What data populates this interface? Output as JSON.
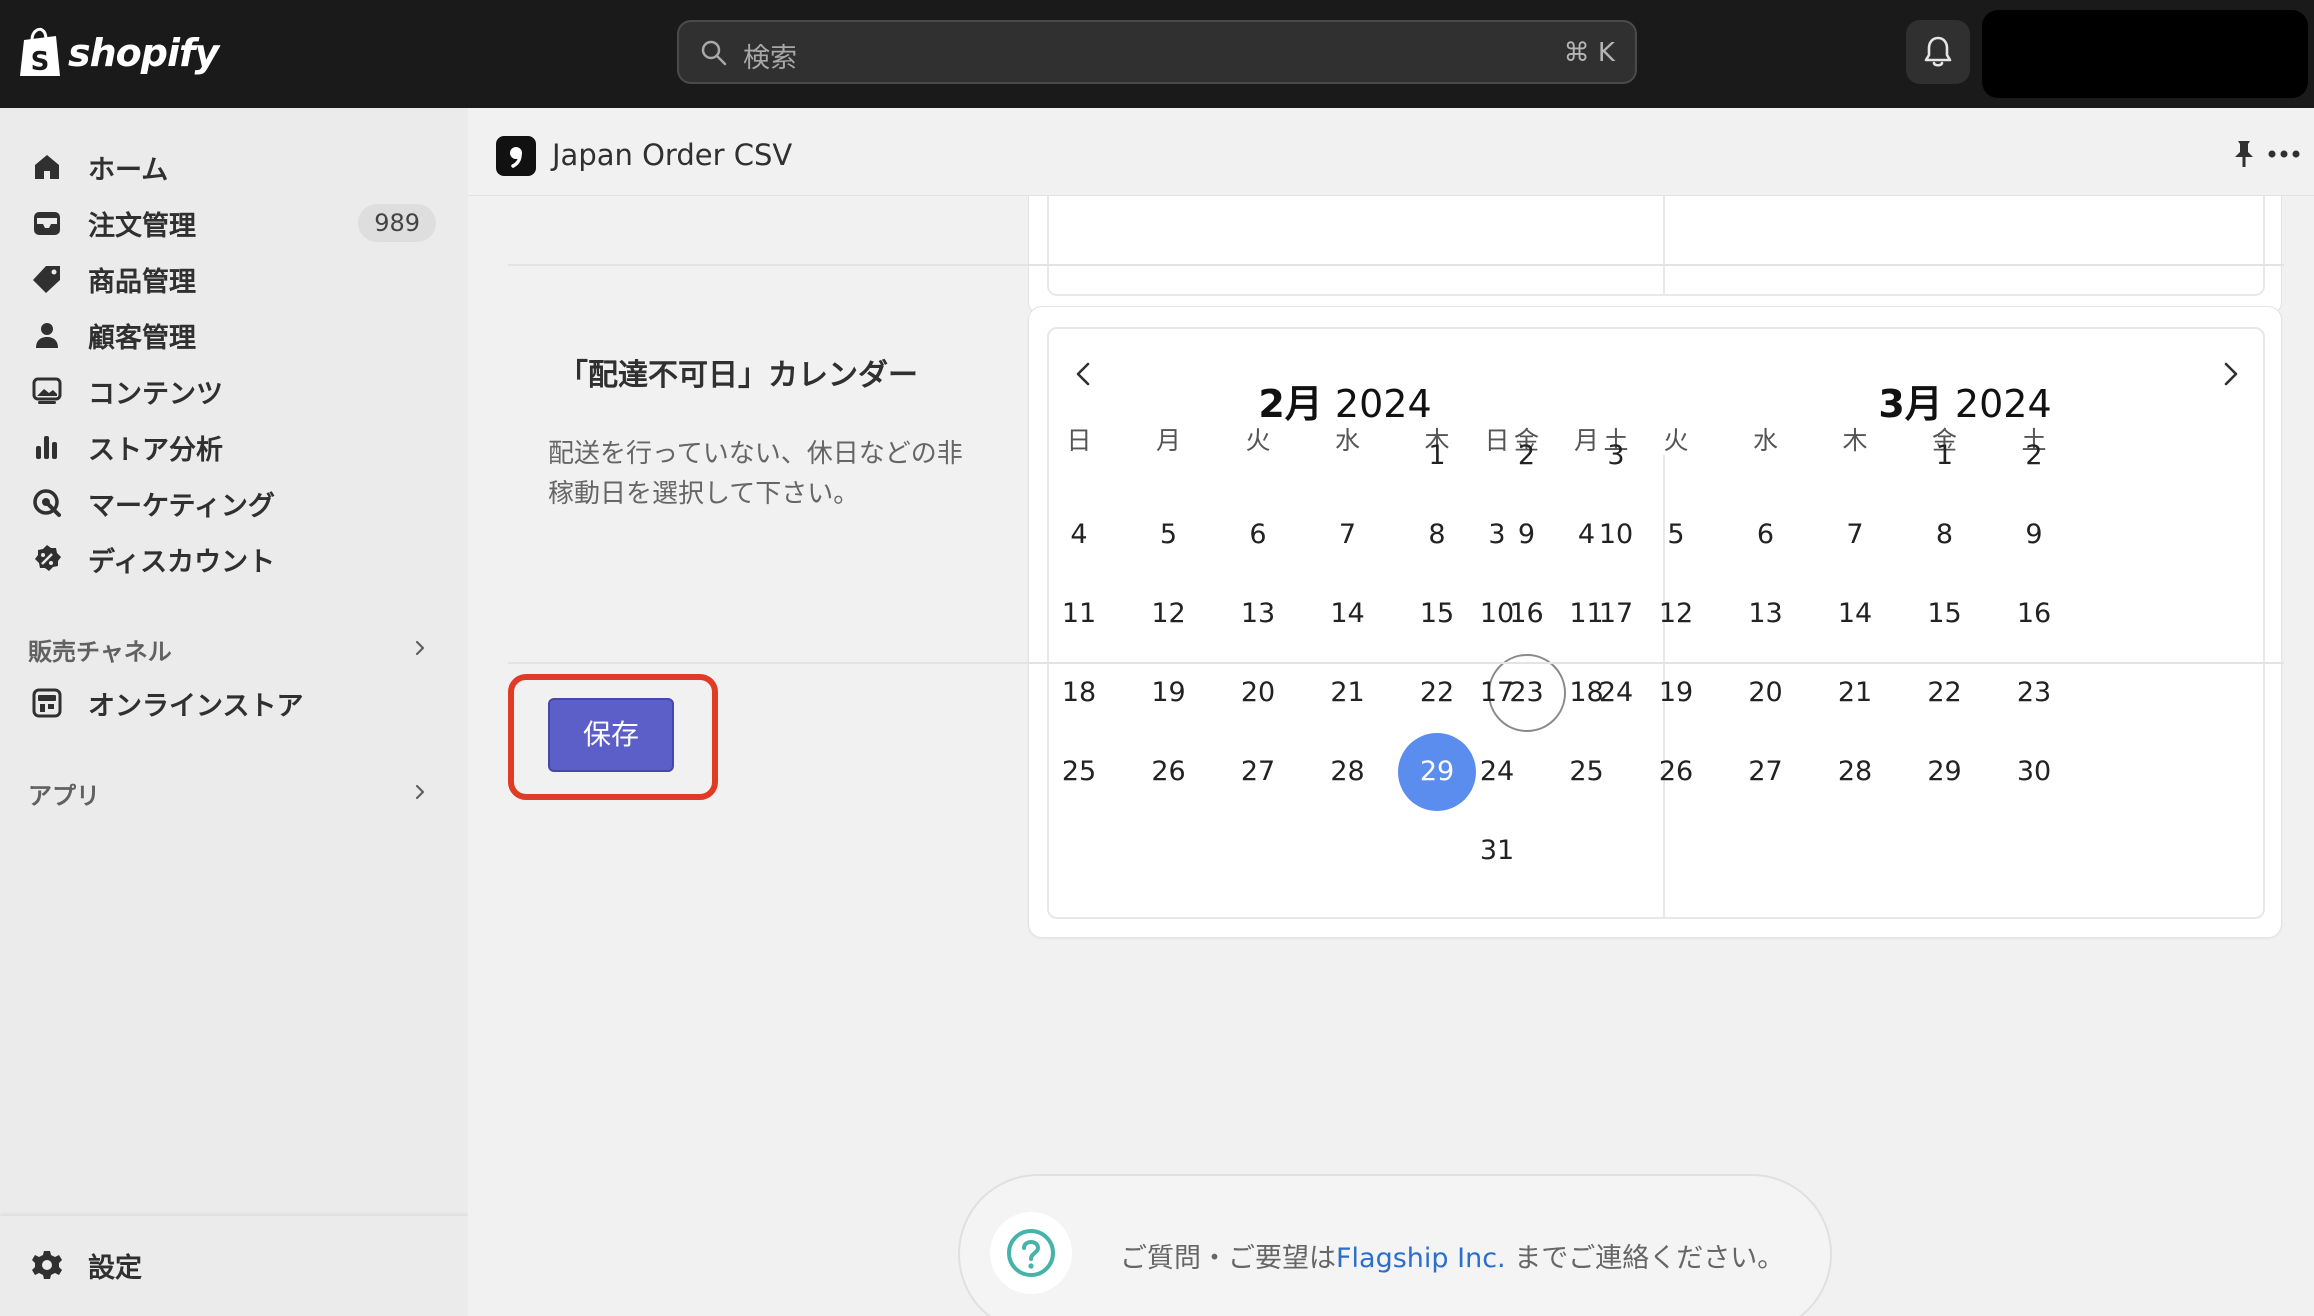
{
  "topbar": {
    "logo_text": "shopify",
    "search_placeholder": "検索",
    "search_shortcut": "⌘ K",
    "bell_icon": "bell-icon"
  },
  "sidebar": {
    "items": [
      {
        "label": "ホーム",
        "icon": "home-icon"
      },
      {
        "label": "注文管理",
        "icon": "inbox-icon",
        "badge": "989"
      },
      {
        "label": "商品管理",
        "icon": "tag-icon"
      },
      {
        "label": "顧客管理",
        "icon": "person-icon"
      },
      {
        "label": "コンテンツ",
        "icon": "image-icon"
      },
      {
        "label": "ストア分析",
        "icon": "bar-chart-icon"
      },
      {
        "label": "マーケティング",
        "icon": "target-icon"
      },
      {
        "label": "ディスカウント",
        "icon": "discount-icon"
      }
    ],
    "sales_channel_label": "販売チャネル",
    "online_store_label": "オンラインストア",
    "apps_label": "アプリ",
    "settings_label": "設定"
  },
  "app": {
    "title": "Japan Order CSV"
  },
  "section": {
    "title": "「配達不可日」カレンダー",
    "description": "配送を行っていない、休日などの非稼動日を選択して下さい。"
  },
  "calendar": {
    "weekdays": [
      "日",
      "月",
      "火",
      "水",
      "木",
      "金",
      "土"
    ],
    "months": [
      {
        "month_label": "2月",
        "year_label": "2024",
        "first_weekday": 4,
        "days": 29,
        "today": 23,
        "selected": [
          29
        ]
      },
      {
        "month_label": "3月",
        "year_label": "2024",
        "first_weekday": 5,
        "days": 31,
        "today": null,
        "selected": []
      }
    ]
  },
  "save_label": "保存",
  "footer": {
    "text_before": "ご質問・ご要望は",
    "link_text": "Flagship Inc.",
    "text_after": " までご連絡ください。"
  },
  "colors": {
    "topbar": "#1a1a1a",
    "selected_day": "#5b8def",
    "save_button": "#5b5fc7",
    "highlight": "#e03b24",
    "link": "#2c6ecb",
    "help_icon": "#47b3a8"
  }
}
